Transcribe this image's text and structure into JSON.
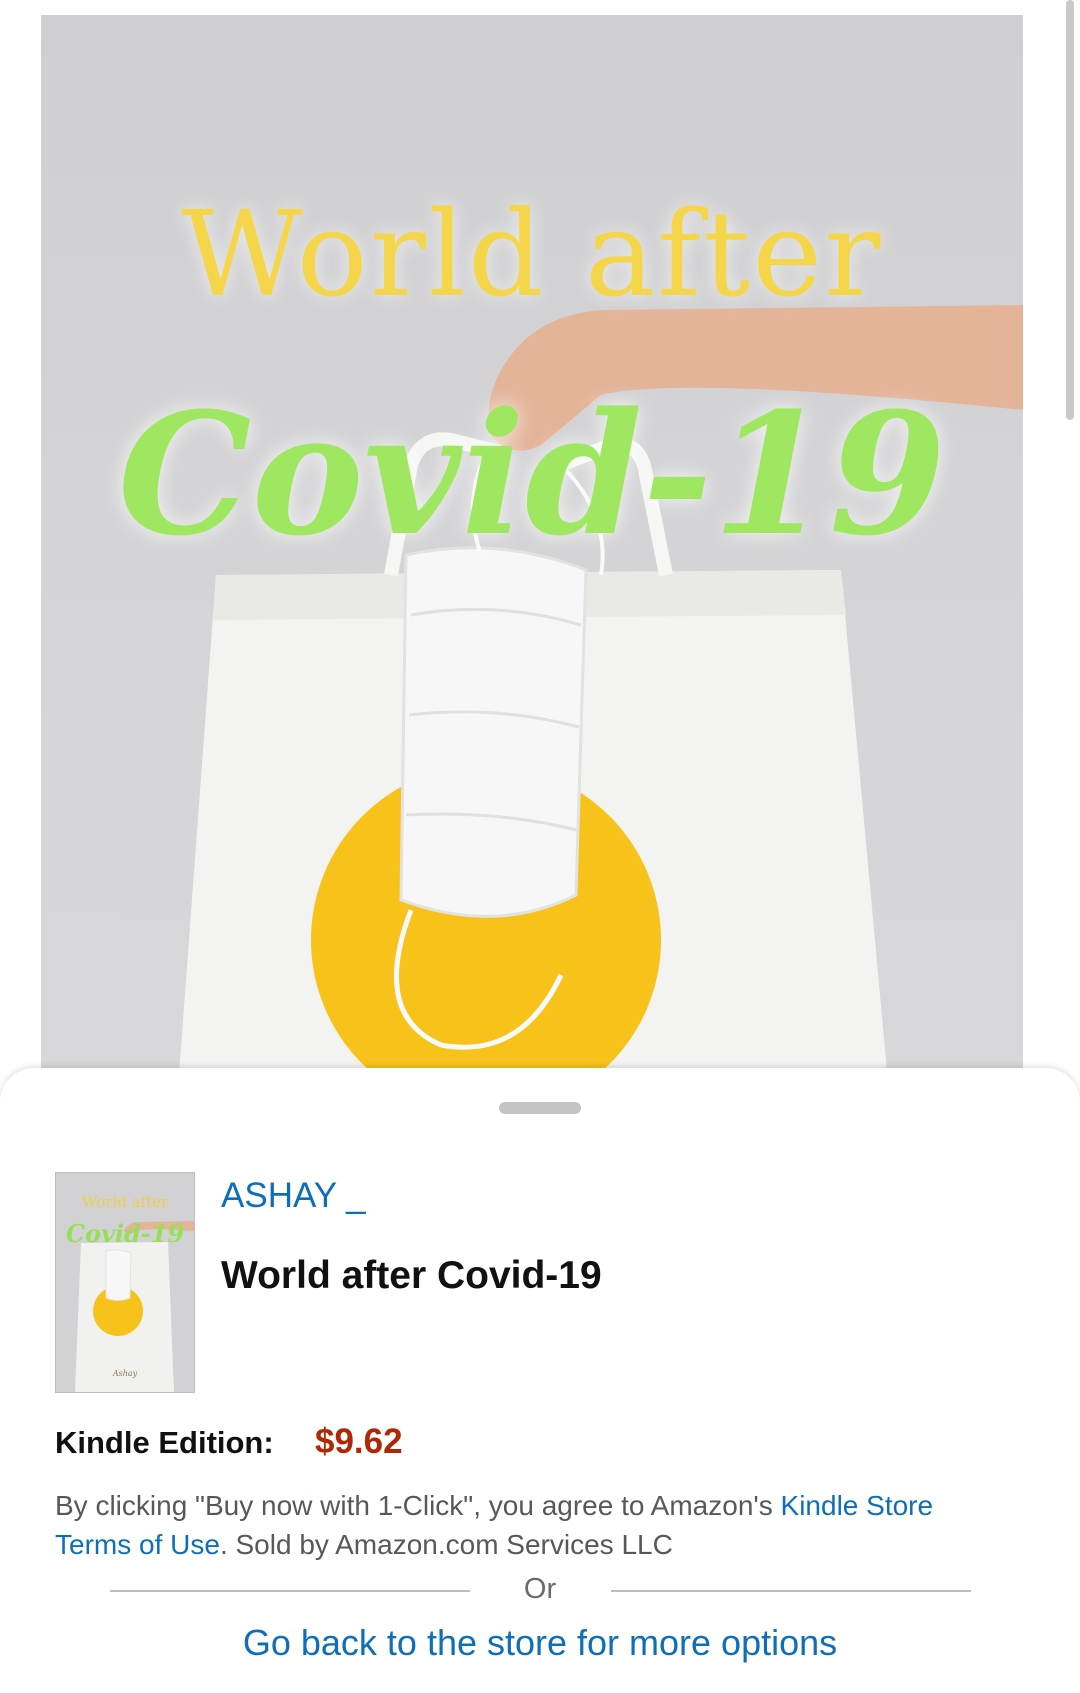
{
  "cover": {
    "title_line1": "World after",
    "title_line2": "Covid-19",
    "colors": {
      "title_line1": "#f5d64a",
      "title_line2": "#9fe760",
      "circle": "#f7c21a",
      "background": "#d4d4d6"
    }
  },
  "sheet": {
    "thumbnail": {
      "title_line1": "World after",
      "title_line2": "Covid-19",
      "author_signature": "Ashay"
    },
    "author": "ASHAY _",
    "title": "World after Covid-19",
    "edition_label": "Kindle Edition:",
    "price": "$9.62",
    "legal": {
      "prefix": "By clicking \"Buy now with 1-Click\", you agree to Amazon's ",
      "link": "Kindle Store Terms of Use",
      "suffix": ". Sold by Amazon.com Services LLC"
    },
    "or_label": "Or",
    "back_link": "Go back to the store for more options"
  },
  "colors": {
    "link": "#0e6fb8",
    "price": "#b12704",
    "text": "#111111",
    "muted": "#565959"
  }
}
